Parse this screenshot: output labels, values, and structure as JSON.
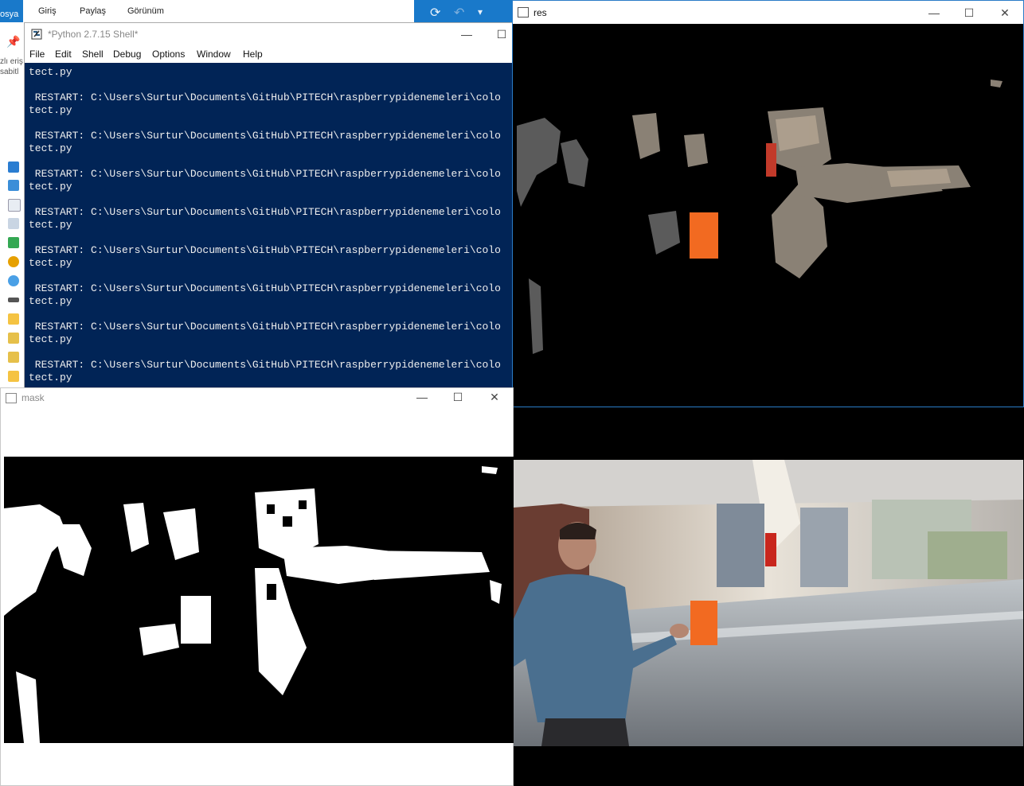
{
  "explorer": {
    "tabs": [
      "osya",
      "Giriş",
      "Paylaş",
      "Görünüm"
    ],
    "side_text": [
      "zlı eriş",
      "sabitl"
    ]
  },
  "shell": {
    "title": "*Python 2.7.15 Shell*",
    "menus": [
      "File",
      "Edit",
      "Shell",
      "Debug",
      "Options",
      "Window",
      "Help"
    ],
    "lines": [
      "tect.py",
      "",
      " RESTART: C:\\Users\\Surtur\\Documents\\GitHub\\PITECH\\raspberrypidenemeleri\\colo",
      "tect.py",
      "",
      " RESTART: C:\\Users\\Surtur\\Documents\\GitHub\\PITECH\\raspberrypidenemeleri\\colo",
      "tect.py",
      "",
      " RESTART: C:\\Users\\Surtur\\Documents\\GitHub\\PITECH\\raspberrypidenemeleri\\colo",
      "tect.py",
      "",
      " RESTART: C:\\Users\\Surtur\\Documents\\GitHub\\PITECH\\raspberrypidenemeleri\\colo",
      "tect.py",
      "",
      " RESTART: C:\\Users\\Surtur\\Documents\\GitHub\\PITECH\\raspberrypidenemeleri\\colo",
      "tect.py",
      "",
      " RESTART: C:\\Users\\Surtur\\Documents\\GitHub\\PITECH\\raspberrypidenemeleri\\colo",
      "tect.py",
      "",
      " RESTART: C:\\Users\\Surtur\\Documents\\GitHub\\PITECH\\raspberrypidenemeleri\\colo",
      "tect.py",
      "",
      " RESTART: C:\\Users\\Surtur\\Documents\\GitHub\\PITECH\\raspberrypidenemeleri\\colo",
      "tect.py"
    ]
  },
  "res": {
    "title": "res"
  },
  "mask": {
    "title": "mask"
  },
  "icons": {
    "minimize": "—",
    "maximize": "☐",
    "close": "✕",
    "refresh": "⟳",
    "undo": "↶",
    "dropdown": "▾"
  },
  "colors": {
    "console_bg": "#012456",
    "accent": "#1979ca",
    "marker": "#f26a21"
  }
}
